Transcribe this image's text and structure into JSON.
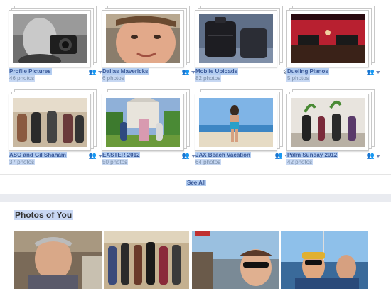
{
  "albums": [
    {
      "title": "Profile Pictures",
      "count": "46 photos",
      "privacy": "friends-icon"
    },
    {
      "title": "Dallas Mavericks",
      "count": "6 photos",
      "privacy": "friends-icon"
    },
    {
      "title": "Mobile Uploads",
      "count": "82 photos",
      "privacy": "gear-icon"
    },
    {
      "title": "Dueling Pianos",
      "count": "5 photos",
      "privacy": "friends-icon"
    },
    {
      "title": "ASO and Gil Shaham",
      "count": "37 photos",
      "privacy": "friends-icon"
    },
    {
      "title": "EASTER 2012",
      "count": "50 photos",
      "privacy": "friends-icon"
    },
    {
      "title": "JAX Beach Vacation",
      "count": "64 photos",
      "privacy": "friends-icon"
    },
    {
      "title": "Palm Sunday 2012",
      "count": "42 photos",
      "privacy": "friends-icon"
    }
  ],
  "see_all": "See All",
  "photos_of_you": {
    "title": "Photos of You"
  },
  "colors": {
    "link": "#3b5998",
    "highlight": "#b3cdf1",
    "divider": "#e9ebf0"
  }
}
